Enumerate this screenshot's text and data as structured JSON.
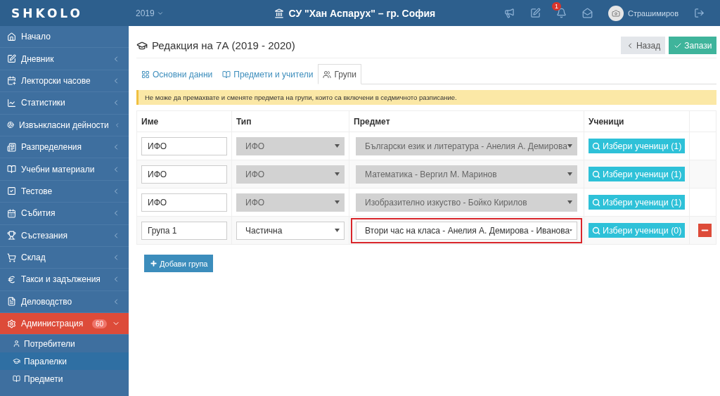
{
  "header": {
    "logo": "SHKOLO",
    "year": "2019",
    "school": "СУ \"Хан Аспарух\" – гр. София",
    "notification_count": "1",
    "user": "Страшимиров"
  },
  "sidebar": {
    "items": [
      {
        "label": "Начало",
        "kind": "link",
        "expanded": false
      },
      {
        "label": "Дневник",
        "kind": "menu",
        "expanded": false
      },
      {
        "label": "Лекторски часове",
        "kind": "menu",
        "expanded": false
      },
      {
        "label": "Статистики",
        "kind": "menu",
        "expanded": false
      },
      {
        "label": "Извънкласни дейности",
        "kind": "menu",
        "expanded": false
      },
      {
        "label": "Разпределения",
        "kind": "menu",
        "expanded": false
      },
      {
        "label": "Учебни материали",
        "kind": "menu",
        "expanded": false
      },
      {
        "label": "Тестове",
        "kind": "menu",
        "expanded": false
      },
      {
        "label": "Събития",
        "kind": "menu",
        "expanded": false
      },
      {
        "label": "Състезания",
        "kind": "menu",
        "expanded": false
      },
      {
        "label": "Склад",
        "kind": "menu",
        "expanded": false
      },
      {
        "label": "Такси и задължения",
        "kind": "menu",
        "expanded": false
      },
      {
        "label": "Деловодство",
        "kind": "menu",
        "expanded": false
      },
      {
        "label": "Администрация",
        "kind": "menu",
        "expanded": true,
        "badge": "60",
        "children": [
          {
            "label": "Потребители",
            "selected": false
          },
          {
            "label": "Паралелки",
            "selected": true
          },
          {
            "label": "Предмети",
            "selected": false
          }
        ]
      }
    ]
  },
  "page": {
    "title": "Редакция на 7А (2019 - 2020)",
    "back_button": "Назад",
    "save_button": "Запази"
  },
  "tabs": [
    {
      "label": "Основни данни",
      "selected": false
    },
    {
      "label": "Предмети и учители",
      "selected": false
    },
    {
      "label": "Групи",
      "selected": true
    }
  ],
  "alert": "Не може да премахвате и сменяте предмета на групи, които са включени в седмичното разписание.",
  "table": {
    "columns": [
      "Име",
      "Тип",
      "Предмет",
      "Ученици"
    ],
    "rows": [
      {
        "name": "ИФО",
        "type": "ИФО",
        "subject": "Български език и литература - Анелия А. Демирова",
        "students_button": "Избери ученици (1)",
        "disabled": true,
        "highlighted": false,
        "removable": false
      },
      {
        "name": "ИФО",
        "type": "ИФО",
        "subject": "Математика - Вергил М. Маринов",
        "students_button": "Избери ученици (1)",
        "disabled": true,
        "highlighted": false,
        "removable": false
      },
      {
        "name": "ИФО",
        "type": "ИФО",
        "subject": "Изобразително изкуство - Бойко Кирилов",
        "students_button": "Избери ученици (1)",
        "disabled": true,
        "highlighted": false,
        "removable": false
      },
      {
        "name": "Група 1",
        "type": "Частична",
        "subject": "Втори час на класа - Анелия А. Демирова - Иванова",
        "students_button": "Избери ученици (0)",
        "disabled": false,
        "highlighted": true,
        "removable": true
      }
    ]
  },
  "add_button": "Добави група"
}
